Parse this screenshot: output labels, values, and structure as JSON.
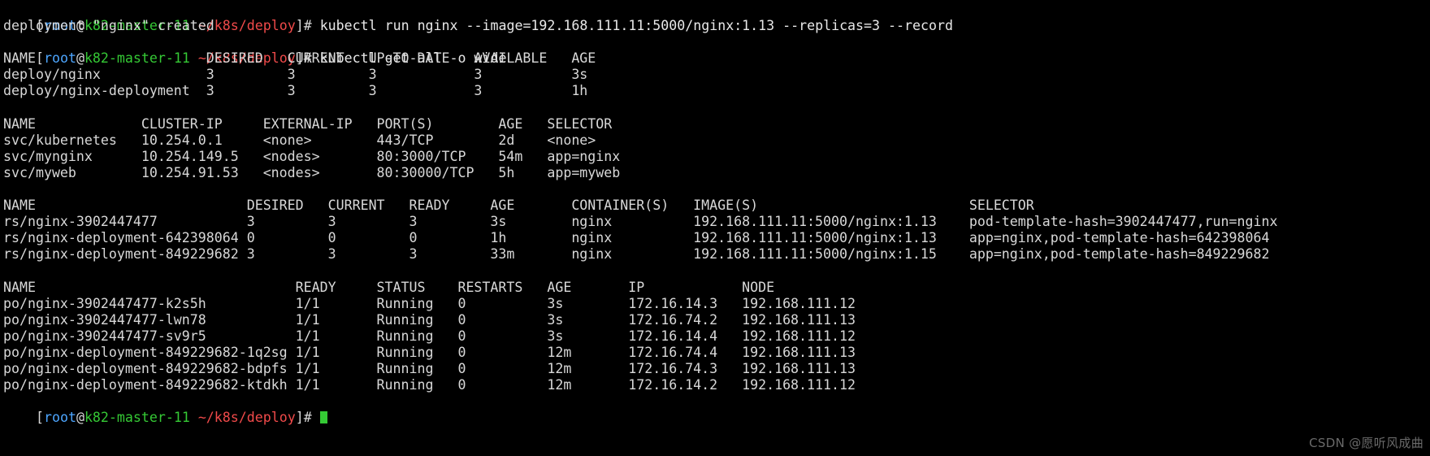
{
  "terminal": {
    "prompt": {
      "open_bracket": "[",
      "user": "root",
      "at": "@",
      "host": "k82-master-11",
      "space": " ",
      "path": "~/k8s/deploy",
      "close_bracket": "]#",
      "trailing_space": " "
    },
    "commands": {
      "run_nginx": "kubectl run nginx --image=192.168.111.11:5000/nginx:1.13 --replicas=3 --record",
      "get_all_wide": "kubectl get all -o wide"
    },
    "messages": {
      "deployment_created": "deployment \"nginx\" created"
    },
    "deployments": {
      "header": "NAME                     DESIRED   CURRENT   UP-TO-DATE   AVAILABLE   AGE",
      "rows": [
        "deploy/nginx             3         3         3            3           3s",
        "deploy/nginx-deployment  3         3         3            3           1h"
      ]
    },
    "services": {
      "header": "NAME             CLUSTER-IP     EXTERNAL-IP   PORT(S)        AGE   SELECTOR",
      "rows": [
        "svc/kubernetes   10.254.0.1     <none>        443/TCP        2d    <none>",
        "svc/mynginx      10.254.149.5   <nodes>       80:3000/TCP    54m   app=nginx",
        "svc/myweb        10.254.91.53   <nodes>       80:30000/TCP   5h    app=myweb"
      ]
    },
    "replicasets": {
      "header": "NAME                          DESIRED   CURRENT   READY     AGE       CONTAINER(S)   IMAGE(S)                          SELECTOR",
      "rows": [
        "rs/nginx-3902447477           3         3         3         3s        nginx          192.168.111.11:5000/nginx:1.13    pod-template-hash=3902447477,run=nginx",
        "rs/nginx-deployment-642398064 0         0         0         1h        nginx          192.168.111.11:5000/nginx:1.13    app=nginx,pod-template-hash=642398064",
        "rs/nginx-deployment-849229682 3         3         3         33m       nginx          192.168.111.11:5000/nginx:1.15    app=nginx,pod-template-hash=849229682"
      ]
    },
    "pods": {
      "header": "NAME                                READY     STATUS    RESTARTS   AGE       IP            NODE",
      "rows": [
        "po/nginx-3902447477-k2s5h           1/1       Running   0          3s        172.16.14.3   192.168.111.12",
        "po/nginx-3902447477-lwn78           1/1       Running   0          3s        172.16.74.2   192.168.111.13",
        "po/nginx-3902447477-sv9r5           1/1       Running   0          3s        172.16.14.4   192.168.111.12",
        "po/nginx-deployment-849229682-1q2sg 1/1       Running   0          12m       172.16.74.4   192.168.111.13",
        "po/nginx-deployment-849229682-bdpfs 1/1       Running   0          12m       172.16.74.3   192.168.111.13",
        "po/nginx-deployment-849229682-ktdkh 1/1       Running   0          12m       172.16.14.2   192.168.111.12"
      ]
    }
  },
  "watermark": {
    "text": "CSDN @愿听风成曲"
  },
  "colors": {
    "background": "#000000",
    "foreground": "#d8d8d8",
    "user": "#4da6ff",
    "host": "#35c935",
    "path": "#f04a4a",
    "cursor": "#35c935"
  }
}
